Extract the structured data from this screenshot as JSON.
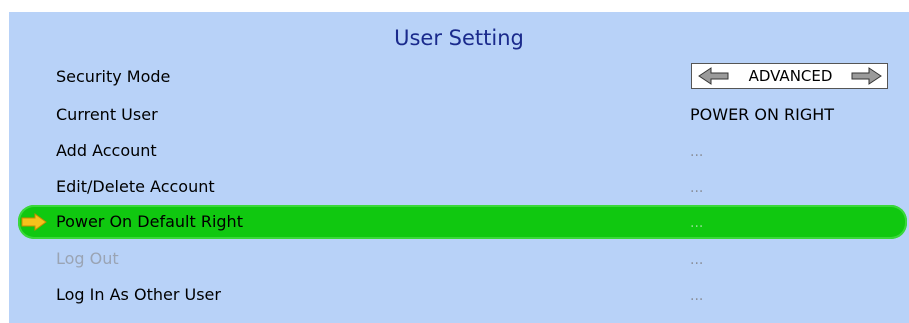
{
  "title": "User Setting",
  "rows": [
    {
      "label": "Security Mode",
      "value": "ADVANCED"
    },
    {
      "label": "Current User",
      "value": "POWER ON RIGHT"
    },
    {
      "label": "Add Account",
      "value": "..."
    },
    {
      "label": "Edit/Delete Account",
      "value": "..."
    },
    {
      "label": "Power On Default Right",
      "value": "..."
    },
    {
      "label": "Log Out",
      "value": "..."
    },
    {
      "label": "Log In As Other User",
      "value": "..."
    }
  ],
  "icons": {
    "selection": "right-arrow-icon",
    "decrement": "left-arrow-icon",
    "increment": "right-arrow-icon"
  },
  "colors": {
    "panel_background": "#b8d2f8",
    "title_text": "#1a2a8c",
    "selected_row": "#10c810",
    "selection_arrow": "#f7c21b",
    "disabled_text": "#9aa4b4"
  }
}
